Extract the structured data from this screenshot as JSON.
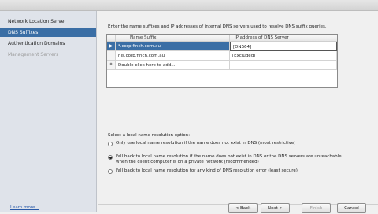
{
  "sidebar": {
    "items": [
      {
        "label": "Network Location Server",
        "state": "normal"
      },
      {
        "label": "DNS Suffixes",
        "state": "selected"
      },
      {
        "label": "Authentication Domains",
        "state": "normal"
      },
      {
        "label": "Management Servers",
        "state": "disabled"
      }
    ],
    "learn_more": "Learn more..."
  },
  "main": {
    "intro": "Enter the name suffixes and IP addresses of internal DNS servers used to resolve DNS suffix queries.",
    "grid": {
      "columns": [
        "Name Suffix",
        "IP address of DNS Server"
      ],
      "rows": [
        {
          "marker": "▶",
          "suffix": "*.corp.finch.com.au",
          "dns": "[DNS64]",
          "selected": true
        },
        {
          "marker": "",
          "suffix": "nls.corp.finch.com.au",
          "dns": "[Excluded]",
          "selected": false
        },
        {
          "marker": "*",
          "suffix": "Double-click here to add...",
          "dns": "",
          "selected": false
        }
      ]
    },
    "resolution_label": "Select a local name resolution option:",
    "options": [
      {
        "label": "Only use local name resolution if the name does not exist in DNS (most restrictive)",
        "checked": false
      },
      {
        "label": "Fall back to local name resolution if the name does not exist in DNS or the DNS servers are unreachable when the client computer is on a private network (recommended)",
        "checked": true
      },
      {
        "label": "Fall back to local name resolution for any kind of DNS resolution error (least secure)",
        "checked": false
      }
    ]
  },
  "buttons": {
    "back": "< Back",
    "next": "Next >",
    "finish": "Finish",
    "cancel": "Cancel"
  }
}
